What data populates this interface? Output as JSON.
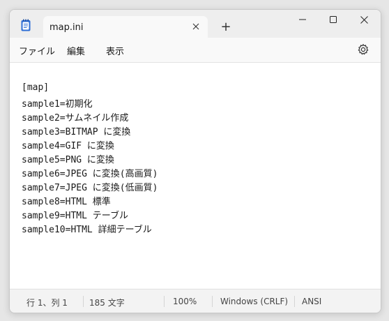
{
  "tab": {
    "title": "map.ini"
  },
  "window": {
    "new_tab": "+"
  },
  "menu": {
    "items": [
      "ファイル",
      "編集",
      "表示"
    ]
  },
  "editor": {
    "lines": [
      "[map]",
      "sample1=初期化",
      "sample2=サムネイル作成",
      "sample3=BITMAP に変換",
      "sample4=GIF に変換",
      "sample5=PNG に変換",
      "sample6=JPEG に変換(高画質)",
      "sample7=JPEG に変換(低画質)",
      "sample8=HTML 標準",
      "sample9=HTML テーブル",
      "sample10=HTML 詳細テーブル"
    ]
  },
  "status": {
    "position": "行 1、列 1",
    "chars": "185 文字",
    "zoom": "100%",
    "line_ending": "Windows (CRLF)",
    "encoding": "ANSI"
  },
  "icons": {
    "app": "notepad-icon",
    "close_tab": "close-icon",
    "minimize": "minimize-icon",
    "maximize": "maximize-icon",
    "close_window": "close-icon",
    "settings": "gear-icon"
  },
  "colors": {
    "accent": "#2f6fd6",
    "background": "#f9f9f9",
    "editor": "#ffffff"
  }
}
